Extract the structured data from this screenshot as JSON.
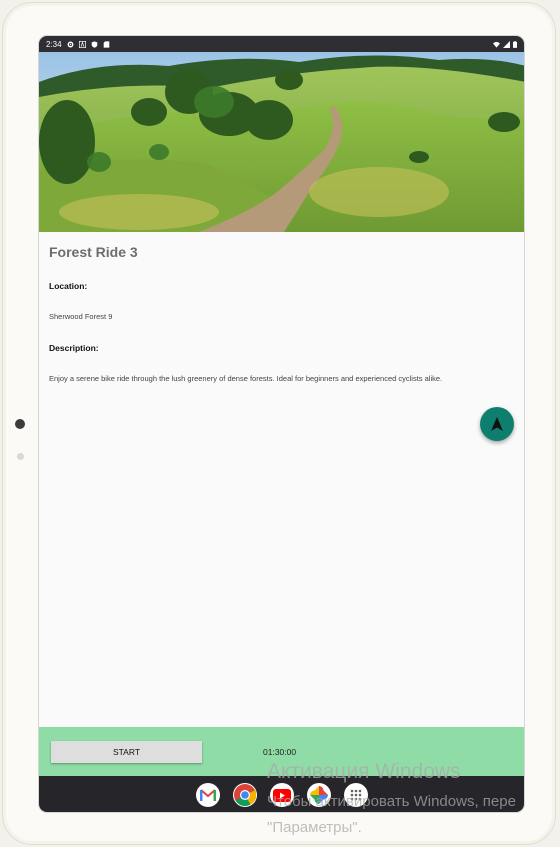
{
  "status_bar": {
    "time": "2:34",
    "left_icons": [
      "gear-icon",
      "a-icon",
      "shield-icon",
      "sd-card-icon"
    ],
    "right_icons": [
      "wifi-icon",
      "signal-icon",
      "battery-icon"
    ]
  },
  "ride": {
    "title": "Forest Ride 3",
    "location_label": "Location:",
    "location_value": "Sherwood Forest 9",
    "description_label": "Description:",
    "description_value": "Enjoy a serene bike ride through the lush greenery of dense forests. Ideal for beginners and experienced cyclists alike."
  },
  "fab": {
    "icon": "navigation-arrow-icon",
    "color": "#0e7f6f"
  },
  "bottom_bar": {
    "start_label": "START",
    "timer": "01:30:00",
    "color": "#8fdca7"
  },
  "nav_apps": [
    "gmail-icon",
    "chrome-icon",
    "youtube-icon",
    "photos-icon",
    "app-launcher-icon"
  ],
  "watermark": {
    "line1": "Активация Windows",
    "line2": "Чтобы активировать Windows, пере",
    "line3": "\"Параметры\"."
  }
}
